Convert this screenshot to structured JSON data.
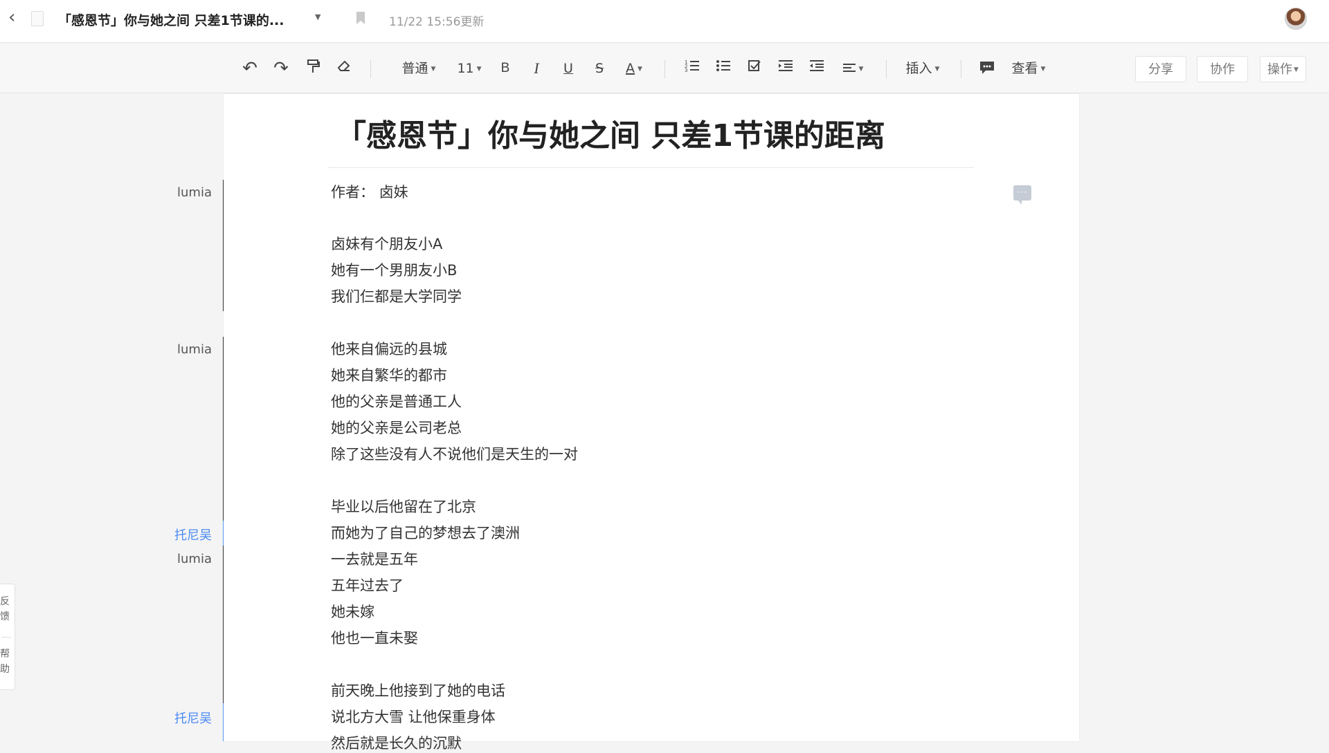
{
  "header": {
    "back_icon": "chevron-left-icon",
    "doc_icon": "document-icon",
    "title": "「感恩节」你与她之间 只差1节课的...",
    "bookmark_icon": "bookmark-icon",
    "updated": "11/22 15:56更新",
    "avatar": "user-avatar"
  },
  "toolbar": {
    "undo": "↶",
    "redo": "↷",
    "format_painter": "format-painter-icon",
    "clear_format": "eraser-icon",
    "paragraph_style": "普通",
    "font_size": "11",
    "bold": "B",
    "italic": "I",
    "underline": "U",
    "strikethrough": "S",
    "font_color": "A",
    "ordered_list": "ordered-list-icon",
    "bullet_list": "bullet-list-icon",
    "checklist": "checkbox-icon",
    "indent": "indent-icon",
    "outdent": "outdent-icon",
    "align": "align-icon",
    "insert": "插入",
    "comment": "comment-icon",
    "view": "查看",
    "share": "分享",
    "collaborate": "协作",
    "actions": "操作"
  },
  "document": {
    "heading": "「感恩节」你与她之间 只差1节课的距离",
    "lines": [
      "作者：  卤妹",
      "卤妹有个朋友小A",
      "她有一个男朋友小B",
      "我们仨都是大学同学",
      "他来自偏远的县城",
      "她来自繁华的都市",
      "他的父亲是普通工人",
      "她的父亲是公司老总",
      "除了这些没有人不说他们是天生的一对",
      "毕业以后他留在了北京",
      "而她为了自己的梦想去了澳洲",
      "一去就是五年",
      "五年过去了",
      "她未嫁",
      "他也一直未娶",
      "前天晚上他接到了她的电话",
      "说北方大雪 让他保重身体",
      "然后就是长久的沉默"
    ]
  },
  "authors": [
    {
      "name": "lumia"
    },
    {
      "name": "lumia"
    },
    {
      "name": "托尼吴"
    },
    {
      "name": "lumia"
    },
    {
      "name": "托尼吴"
    }
  ],
  "side_panel": {
    "feedback": "反馈",
    "help": "帮助"
  },
  "colors": {
    "author_dark": "#333333",
    "author_blue": "#4a8af4"
  }
}
